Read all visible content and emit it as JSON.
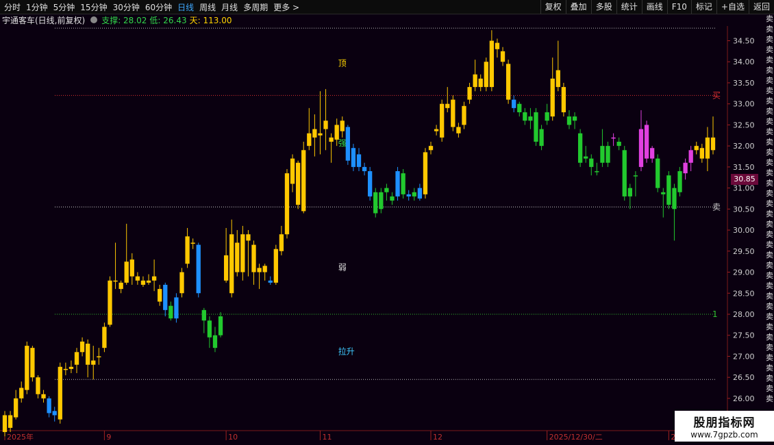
{
  "toolbar": {
    "periods": [
      "分时",
      "1分钟",
      "5分钟",
      "15分钟",
      "30分钟",
      "60分钟",
      "日线",
      "周线",
      "月线",
      "多周期",
      "更多 >"
    ],
    "active_period": "日线",
    "right_buttons": [
      "复权",
      "叠加",
      "多股",
      "统计",
      "画线",
      "F10",
      "标记",
      "+自选",
      "返回"
    ]
  },
  "info": {
    "name": "宇通客车(日线,前复权)",
    "support": "支撑: 28.02",
    "low": "低: 26.43",
    "day": "天: 113.00"
  },
  "price_tag": "30.85",
  "right_strip": [
    "卖",
    "卖",
    "卖",
    "卖",
    "卖",
    "卖",
    "卖",
    "卖",
    "卖",
    "卖",
    "卖",
    "卖",
    "卖",
    "卖",
    "卖",
    "卖",
    "卖",
    "卖",
    "卖",
    "卖",
    "卖",
    "卖",
    "卖",
    "卖",
    "卖",
    "卖",
    "卖",
    "卖",
    "卖",
    "卖",
    "卖",
    "卖",
    "卖",
    "卖",
    "卖",
    "卖",
    "卖",
    "卖"
  ],
  "watermark": {
    "main": "股朋指标网",
    "sub": "www.7gpzb.com"
  },
  "chart_data": {
    "type": "candlestick",
    "y_ticks": [
      34.5,
      34.0,
      33.5,
      33.0,
      32.5,
      32.0,
      31.5,
      31.0,
      30.5,
      30.0,
      29.5,
      29.0,
      28.5,
      28.0,
      27.5,
      27.0,
      26.5,
      26.0,
      25.5
    ],
    "ylim": [
      25.25,
      34.85
    ],
    "x_ticks": [
      {
        "label": "2025年",
        "index": 0
      },
      {
        "label": "9",
        "index": 18
      },
      {
        "label": "10",
        "index": 40
      },
      {
        "label": "11",
        "index": 57
      },
      {
        "label": "12",
        "index": 77
      },
      {
        "label": "2025/12/30/二",
        "index": 98
      },
      {
        "label": "2",
        "index": 120
      }
    ],
    "hlines": [
      {
        "value": 34.8,
        "color": "#bbbbbb",
        "style": "dotted"
      },
      {
        "value": 33.2,
        "color": "#e03030",
        "style": "dotted",
        "label": "买"
      },
      {
        "value": 30.55,
        "color": "#cccccc",
        "style": "dotted",
        "label": "卖"
      },
      {
        "value": 28.0,
        "color": "#30c030",
        "style": "dotted",
        "label": "1"
      },
      {
        "value": 26.45,
        "color": "#bbbbbb",
        "style": "dotted"
      }
    ],
    "annotations": [
      {
        "text": "顶",
        "index": 61,
        "value": 33.9,
        "color": "#ffd400"
      },
      {
        "text": "弱",
        "index": 61,
        "value": 29.05,
        "color": "#e0e0e0"
      },
      {
        "text": "拉升",
        "index": 61,
        "value": 27.05,
        "color": "#3fc8ff"
      },
      {
        "text": "强",
        "index": 61,
        "value": 32.0,
        "color": "#32d74b"
      }
    ],
    "candles": [
      {
        "o": 25.6,
        "c": 25.2,
        "h": 25.7,
        "l": 25.1,
        "col": "y"
      },
      {
        "o": 25.3,
        "c": 25.6,
        "h": 25.7,
        "l": 25.2,
        "col": "y"
      },
      {
        "o": 25.55,
        "c": 26.0,
        "h": 26.2,
        "l": 25.5,
        "col": "y"
      },
      {
        "o": 26.0,
        "c": 26.25,
        "h": 26.4,
        "l": 25.9,
        "col": "y"
      },
      {
        "o": 26.2,
        "c": 27.25,
        "h": 27.35,
        "l": 26.1,
        "col": "y"
      },
      {
        "o": 27.2,
        "c": 26.5,
        "h": 27.25,
        "l": 26.4,
        "col": "y"
      },
      {
        "o": 26.5,
        "c": 26.1,
        "h": 26.55,
        "l": 26.0,
        "col": "y"
      },
      {
        "o": 26.1,
        "c": 26.0,
        "h": 26.2,
        "l": 25.9,
        "col": "y"
      },
      {
        "o": 26.0,
        "c": 25.65,
        "h": 26.05,
        "l": 25.55,
        "col": "b"
      },
      {
        "o": 25.7,
        "c": 25.6,
        "h": 25.8,
        "l": 25.45,
        "col": "b"
      },
      {
        "o": 25.5,
        "c": 26.75,
        "h": 26.85,
        "l": 25.4,
        "col": "y"
      },
      {
        "o": 26.7,
        "c": 26.7,
        "h": 26.85,
        "l": 26.55,
        "col": "y"
      },
      {
        "o": 26.7,
        "c": 26.75,
        "h": 26.9,
        "l": 26.6,
        "col": "y"
      },
      {
        "o": 26.8,
        "c": 27.1,
        "h": 27.2,
        "l": 26.6,
        "col": "y"
      },
      {
        "o": 27.1,
        "c": 27.35,
        "h": 27.45,
        "l": 27.0,
        "col": "y"
      },
      {
        "o": 27.3,
        "c": 26.8,
        "h": 27.4,
        "l": 26.5,
        "col": "y"
      },
      {
        "o": 26.8,
        "c": 26.9,
        "h": 27.25,
        "l": 26.45,
        "col": "y"
      },
      {
        "o": 27.0,
        "c": 27.0,
        "h": 27.2,
        "l": 26.8,
        "col": "y"
      },
      {
        "o": 27.2,
        "c": 27.7,
        "h": 27.8,
        "l": 27.1,
        "col": "y"
      },
      {
        "o": 27.75,
        "c": 28.8,
        "h": 28.9,
        "l": 27.7,
        "col": "y"
      },
      {
        "o": 28.8,
        "c": 28.8,
        "h": 29.7,
        "l": 28.6,
        "col": "y"
      },
      {
        "o": 28.6,
        "c": 28.75,
        "h": 28.8,
        "l": 28.5,
        "col": "y"
      },
      {
        "o": 28.75,
        "c": 29.25,
        "h": 30.15,
        "l": 28.7,
        "col": "y"
      },
      {
        "o": 29.3,
        "c": 28.9,
        "h": 29.45,
        "l": 28.7,
        "col": "y"
      },
      {
        "o": 28.9,
        "c": 28.8,
        "h": 29.0,
        "l": 28.7,
        "col": "y"
      },
      {
        "o": 28.8,
        "c": 28.7,
        "h": 28.9,
        "l": 28.65,
        "col": "y"
      },
      {
        "o": 28.75,
        "c": 28.8,
        "h": 28.95,
        "l": 28.7,
        "col": "y"
      },
      {
        "o": 28.9,
        "c": 28.8,
        "h": 29.3,
        "l": 28.55,
        "col": "y"
      },
      {
        "o": 28.6,
        "c": 28.3,
        "h": 28.7,
        "l": 28.2,
        "col": "y"
      },
      {
        "o": 28.7,
        "c": 28.1,
        "h": 28.75,
        "l": 27.95,
        "col": "b"
      },
      {
        "o": 28.2,
        "c": 27.9,
        "h": 28.3,
        "l": 27.85,
        "col": "g"
      },
      {
        "o": 28.4,
        "c": 27.9,
        "h": 28.5,
        "l": 27.8,
        "col": "b"
      },
      {
        "o": 28.5,
        "c": 29.0,
        "h": 29.1,
        "l": 28.4,
        "col": "y"
      },
      {
        "o": 29.2,
        "c": 29.85,
        "h": 30.05,
        "l": 29.1,
        "col": "y"
      },
      {
        "o": 29.7,
        "c": 29.7,
        "h": 29.8,
        "l": 29.55,
        "col": "y"
      },
      {
        "o": 29.65,
        "c": 28.5,
        "h": 29.7,
        "l": 28.4,
        "col": "b"
      },
      {
        "o": 28.1,
        "c": 27.85,
        "h": 28.15,
        "l": 27.55,
        "col": "g"
      },
      {
        "o": 27.85,
        "c": 27.45,
        "h": 27.95,
        "l": 27.2,
        "col": "g"
      },
      {
        "o": 27.5,
        "c": 27.2,
        "h": 27.7,
        "l": 27.1,
        "col": "g"
      },
      {
        "o": 27.5,
        "c": 27.95,
        "h": 28.05,
        "l": 27.45,
        "col": "g"
      },
      {
        "o": 28.8,
        "c": 29.4,
        "h": 30.05,
        "l": 28.75,
        "col": "y"
      },
      {
        "o": 29.9,
        "c": 28.5,
        "h": 30.25,
        "l": 28.4,
        "col": "y"
      },
      {
        "o": 29.7,
        "c": 29.0,
        "h": 30.0,
        "l": 28.9,
        "col": "y"
      },
      {
        "o": 29.0,
        "c": 29.9,
        "h": 30.1,
        "l": 28.8,
        "col": "y"
      },
      {
        "o": 29.75,
        "c": 29.9,
        "h": 30.0,
        "l": 28.9,
        "col": "y"
      },
      {
        "o": 29.65,
        "c": 29.0,
        "h": 29.75,
        "l": 28.7,
        "col": "y"
      },
      {
        "o": 29.1,
        "c": 29.0,
        "h": 29.2,
        "l": 28.6,
        "col": "y"
      },
      {
        "o": 29.15,
        "c": 29.0,
        "h": 29.2,
        "l": 28.8,
        "col": "y"
      },
      {
        "o": 28.8,
        "c": 28.75,
        "h": 28.9,
        "l": 28.7,
        "col": "b"
      },
      {
        "o": 28.75,
        "c": 29.55,
        "h": 29.65,
        "l": 28.7,
        "col": "y"
      },
      {
        "o": 29.5,
        "c": 29.9,
        "h": 30.1,
        "l": 29.4,
        "col": "y"
      },
      {
        "o": 29.9,
        "c": 31.35,
        "h": 31.45,
        "l": 29.8,
        "col": "y"
      },
      {
        "o": 31.1,
        "c": 31.7,
        "h": 31.8,
        "l": 30.9,
        "col": "y"
      },
      {
        "o": 31.6,
        "c": 30.6,
        "h": 31.65,
        "l": 30.5,
        "col": "y"
      },
      {
        "o": 30.45,
        "c": 31.9,
        "h": 32.1,
        "l": 30.4,
        "col": "y"
      },
      {
        "o": 32.0,
        "c": 32.3,
        "h": 32.9,
        "l": 31.9,
        "col": "y"
      },
      {
        "o": 32.2,
        "c": 32.4,
        "h": 32.75,
        "l": 31.75,
        "col": "y"
      },
      {
        "o": 32.25,
        "c": 32.3,
        "h": 33.3,
        "l": 31.8,
        "col": "y"
      },
      {
        "o": 32.4,
        "c": 32.6,
        "h": 33.35,
        "l": 31.9,
        "col": "y"
      },
      {
        "o": 32.2,
        "c": 32.1,
        "h": 32.3,
        "l": 31.6,
        "col": "y"
      },
      {
        "o": 32.15,
        "c": 32.5,
        "h": 32.65,
        "l": 32.0,
        "col": "y"
      },
      {
        "o": 32.35,
        "c": 32.6,
        "h": 32.7,
        "l": 32.2,
        "col": "y"
      },
      {
        "o": 32.45,
        "c": 31.65,
        "h": 32.5,
        "l": 31.55,
        "col": "b"
      },
      {
        "o": 31.95,
        "c": 31.5,
        "h": 32.05,
        "l": 31.4,
        "col": "b"
      },
      {
        "o": 31.8,
        "c": 31.5,
        "h": 31.95,
        "l": 31.4,
        "col": "b"
      },
      {
        "o": 31.5,
        "c": 31.4,
        "h": 31.6,
        "l": 31.3,
        "col": "b"
      },
      {
        "o": 31.4,
        "c": 30.8,
        "h": 31.5,
        "l": 30.7,
        "col": "b"
      },
      {
        "o": 30.4,
        "c": 30.9,
        "h": 31.0,
        "l": 30.3,
        "col": "g"
      },
      {
        "o": 30.5,
        "c": 30.9,
        "h": 31.0,
        "l": 30.4,
        "col": "g"
      },
      {
        "o": 30.9,
        "c": 31.0,
        "h": 31.1,
        "l": 30.7,
        "col": "g"
      },
      {
        "o": 30.7,
        "c": 30.8,
        "h": 30.9,
        "l": 30.6,
        "col": "g"
      },
      {
        "o": 30.8,
        "c": 31.4,
        "h": 31.5,
        "l": 30.7,
        "col": "b"
      },
      {
        "o": 31.35,
        "c": 30.85,
        "h": 31.45,
        "l": 30.75,
        "col": "g"
      },
      {
        "o": 30.85,
        "c": 30.8,
        "h": 30.95,
        "l": 30.7,
        "col": "b"
      },
      {
        "o": 30.8,
        "c": 30.9,
        "h": 31.0,
        "l": 30.7,
        "col": "g"
      },
      {
        "o": 31.0,
        "c": 30.75,
        "h": 31.1,
        "l": 30.7,
        "col": "b"
      },
      {
        "o": 30.85,
        "c": 31.85,
        "h": 31.95,
        "l": 30.75,
        "col": "y"
      },
      {
        "o": 31.9,
        "c": 32.0,
        "h": 32.1,
        "l": 31.8,
        "col": "y"
      },
      {
        "o": 32.35,
        "c": 32.4,
        "h": 32.5,
        "l": 32.25,
        "col": "y"
      },
      {
        "o": 32.2,
        "c": 33.0,
        "h": 33.1,
        "l": 32.1,
        "col": "y"
      },
      {
        "o": 32.9,
        "c": 33.0,
        "h": 33.4,
        "l": 32.8,
        "col": "y"
      },
      {
        "o": 33.1,
        "c": 32.45,
        "h": 33.2,
        "l": 32.35,
        "col": "y"
      },
      {
        "o": 32.45,
        "c": 32.3,
        "h": 32.55,
        "l": 32.2,
        "col": "y"
      },
      {
        "o": 32.5,
        "c": 32.95,
        "h": 33.05,
        "l": 32.4,
        "col": "y"
      },
      {
        "o": 33.1,
        "c": 33.4,
        "h": 33.5,
        "l": 33.0,
        "col": "y"
      },
      {
        "o": 33.4,
        "c": 33.7,
        "h": 34.05,
        "l": 33.3,
        "col": "y"
      },
      {
        "o": 33.6,
        "c": 33.4,
        "h": 33.7,
        "l": 33.3,
        "col": "y"
      },
      {
        "o": 33.4,
        "c": 34.0,
        "h": 34.1,
        "l": 33.3,
        "col": "y"
      },
      {
        "o": 33.4,
        "c": 34.5,
        "h": 34.75,
        "l": 33.3,
        "col": "y"
      },
      {
        "o": 34.3,
        "c": 34.45,
        "h": 34.55,
        "l": 34.1,
        "col": "y"
      },
      {
        "o": 34.25,
        "c": 34.0,
        "h": 34.35,
        "l": 33.9,
        "col": "y"
      },
      {
        "o": 33.95,
        "c": 33.1,
        "h": 34.05,
        "l": 33.0,
        "col": "y"
      },
      {
        "o": 33.1,
        "c": 32.9,
        "h": 33.2,
        "l": 32.8,
        "col": "b"
      },
      {
        "o": 33.0,
        "c": 32.8,
        "h": 33.05,
        "l": 32.7,
        "col": "g"
      },
      {
        "o": 32.8,
        "c": 32.6,
        "h": 32.9,
        "l": 32.5,
        "col": "g"
      },
      {
        "o": 32.7,
        "c": 32.6,
        "h": 32.9,
        "l": 32.4,
        "col": "g"
      },
      {
        "o": 32.8,
        "c": 32.1,
        "h": 32.9,
        "l": 32.0,
        "col": "g"
      },
      {
        "o": 32.4,
        "c": 32.0,
        "h": 32.5,
        "l": 31.9,
        "col": "g"
      },
      {
        "o": 32.6,
        "c": 32.8,
        "h": 33.0,
        "l": 32.5,
        "col": "g"
      },
      {
        "o": 32.7,
        "c": 33.6,
        "h": 34.1,
        "l": 32.6,
        "col": "y"
      },
      {
        "o": 33.8,
        "c": 33.4,
        "h": 34.5,
        "l": 33.3,
        "col": "y"
      },
      {
        "o": 33.4,
        "c": 32.8,
        "h": 33.5,
        "l": 32.7,
        "col": "y"
      },
      {
        "o": 32.7,
        "c": 32.5,
        "h": 32.85,
        "l": 32.4,
        "col": "g"
      },
      {
        "o": 32.7,
        "c": 32.6,
        "h": 32.8,
        "l": 32.4,
        "col": "g"
      },
      {
        "o": 32.3,
        "c": 31.6,
        "h": 32.4,
        "l": 31.5,
        "col": "g"
      },
      {
        "o": 31.7,
        "c": 31.75,
        "h": 32.0,
        "l": 31.6,
        "col": "g"
      },
      {
        "o": 31.7,
        "c": 31.5,
        "h": 31.8,
        "l": 31.3,
        "col": "g"
      },
      {
        "o": 31.4,
        "c": 31.4,
        "h": 31.6,
        "l": 31.3,
        "col": "g"
      },
      {
        "o": 31.6,
        "c": 32.0,
        "h": 32.4,
        "l": 31.5,
        "col": "g"
      },
      {
        "o": 32.0,
        "c": 31.6,
        "h": 32.1,
        "l": 31.5,
        "col": "g"
      },
      {
        "o": 32.2,
        "c": 32.2,
        "h": 32.3,
        "l": 32.0,
        "col": "m"
      },
      {
        "o": 32.1,
        "c": 32.0,
        "h": 32.2,
        "l": 31.9,
        "col": "g"
      },
      {
        "o": 31.9,
        "c": 30.8,
        "h": 32.0,
        "l": 30.7,
        "col": "g"
      },
      {
        "o": 31.0,
        "c": 30.8,
        "h": 31.1,
        "l": 30.5,
        "col": "g"
      },
      {
        "o": 31.3,
        "c": 31.3,
        "h": 31.4,
        "l": 30.8,
        "col": "g"
      },
      {
        "o": 32.4,
        "c": 31.5,
        "h": 32.85,
        "l": 31.4,
        "col": "m"
      },
      {
        "o": 32.5,
        "c": 31.7,
        "h": 32.6,
        "l": 31.6,
        "col": "m"
      },
      {
        "o": 31.95,
        "c": 31.7,
        "h": 32.0,
        "l": 31.6,
        "col": "m"
      },
      {
        "o": 31.7,
        "c": 31.0,
        "h": 31.8,
        "l": 30.9,
        "col": "g"
      },
      {
        "o": 30.9,
        "c": 30.85,
        "h": 31.0,
        "l": 30.3,
        "col": "g"
      },
      {
        "o": 31.3,
        "c": 30.6,
        "h": 31.4,
        "l": 30.5,
        "col": "g"
      },
      {
        "o": 31.0,
        "c": 30.5,
        "h": 31.1,
        "l": 29.75,
        "col": "g"
      },
      {
        "o": 30.9,
        "c": 31.4,
        "h": 31.5,
        "l": 30.8,
        "col": "g"
      },
      {
        "o": 31.35,
        "c": 31.6,
        "h": 31.7,
        "l": 31.2,
        "col": "m"
      },
      {
        "o": 31.6,
        "c": 31.9,
        "h": 32.0,
        "l": 31.4,
        "col": "m"
      },
      {
        "o": 31.9,
        "c": 32.0,
        "h": 32.1,
        "l": 31.8,
        "col": "y"
      },
      {
        "o": 31.7,
        "c": 31.95,
        "h": 32.05,
        "l": 31.6,
        "col": "y"
      },
      {
        "o": 31.7,
        "c": 32.2,
        "h": 32.45,
        "l": 31.4,
        "col": "y"
      },
      {
        "o": 31.9,
        "c": 32.2,
        "h": 32.7,
        "l": 31.8,
        "col": "y"
      }
    ]
  }
}
